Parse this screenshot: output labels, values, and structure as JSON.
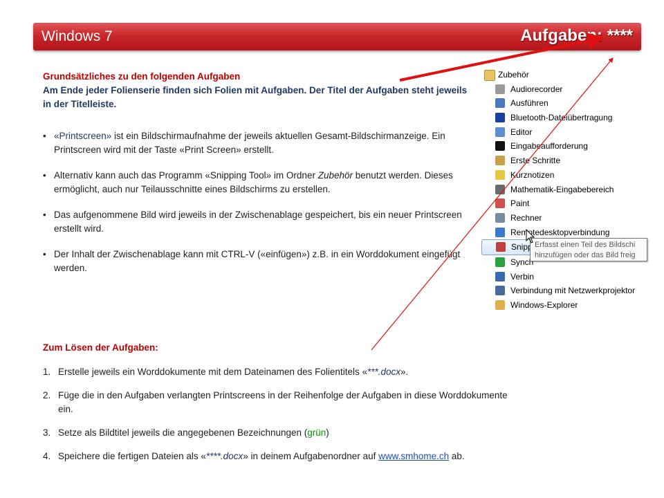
{
  "header": {
    "title": "Windows 7",
    "tasks_label": "Aufgaben: ****"
  },
  "intro": {
    "heading": "Grundsätzliches zu den folgenden Aufgaben",
    "text": "Am Ende jeder Folienserie finden sich Folien mit Aufgaben. Der Titel der Aufgaben steht jeweils in der Titelleiste."
  },
  "bullets": [
    {
      "pre": "«Printscreen»",
      "text": " ist ein Bildschirmaufnahme der jeweils aktuellen Gesamt-Bildschirmanzeige. Ein Printscreen wird mit der Taste «Print Screen» erstellt."
    },
    {
      "a": "Alternativ kann auch das Programm «Snipping Tool» im Ordner ",
      "em": "Zubehör",
      "b": " benutzt werden. Dieses ermöglicht, auch nur Teilausschnitte eines Bildschirms zu erstellen."
    },
    {
      "text": "Das aufgenommene Bild wird jeweils in der Zwischenablage gespeichert, bis ein neuer Printscreen erstellt wird."
    },
    {
      "text": "Der Inhalt der Zwischenablage kann mit CTRL-V («einfügen») z.B. in ein Worddokument eingefügt werden."
    }
  ],
  "solve": {
    "heading": "Zum Lösen der Aufgaben:",
    "steps": [
      {
        "num": "1.",
        "a": "Erstelle jeweils ein Worddokumente mit dem Dateinamen des Folientitels «",
        "em": "***.docx",
        "b": "»."
      },
      {
        "num": "2.",
        "text": "Füge die in den Aufgaben verlangten Printscreens in der Reihenfolge der Aufgaben in diese Worddokumente ein."
      },
      {
        "num": "3.",
        "a": "Setze als Bildtitel jeweils die angegebenen Bezeichnungen (",
        "green": "grün",
        "b": ")"
      },
      {
        "num": "4.",
        "a": "Speichere die fertigen Dateien als «",
        "em": "****.docx",
        "b": "» in deinem Aufgabenordner auf ",
        "link": "www.smhome.ch",
        "c": " ab."
      }
    ]
  },
  "start_menu": {
    "folder": "Zubehör",
    "items": [
      {
        "label": "Audiorecorder",
        "color": "#9a9a9a"
      },
      {
        "label": "Ausführen",
        "color": "#4a78c0"
      },
      {
        "label": "Bluetooth-Dateiübertragung",
        "color": "#1a3fa0"
      },
      {
        "label": "Editor",
        "color": "#5c8ed0"
      },
      {
        "label": "Eingabeaufforderung",
        "color": "#111111"
      },
      {
        "label": "Erste Schritte",
        "color": "#c8a24a"
      },
      {
        "label": "Kurznotizen",
        "color": "#e0c840"
      },
      {
        "label": "Mathematik-Eingabebereich",
        "color": "#6a6a6a"
      },
      {
        "label": "Paint",
        "color": "#d05050"
      },
      {
        "label": "Rechner",
        "color": "#7a8aa0"
      },
      {
        "label": "Remotedesktopverbindung",
        "color": "#3a7ac8"
      },
      {
        "label": "Snipping Tool",
        "color": "#c04040",
        "selected": true
      },
      {
        "label": "Synch",
        "color": "#2aa040"
      },
      {
        "label": "Verbin",
        "color": "#3a6ab0"
      },
      {
        "label": "Verbindung mit Netzwerkprojektor",
        "color": "#4a6a9a"
      },
      {
        "label": "Windows-Explorer",
        "color": "#e0b050"
      }
    ],
    "tooltip_line1": "Erfasst einen Teil des Bildschi",
    "tooltip_line2": "hinzufügen oder das Bild freig"
  }
}
